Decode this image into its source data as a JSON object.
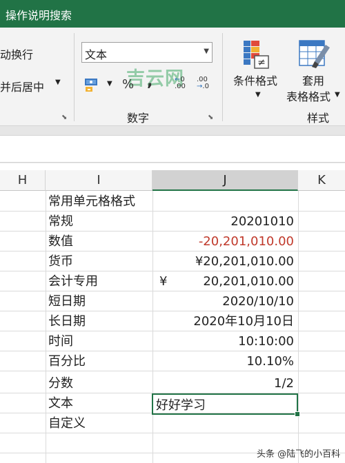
{
  "title_bar": {
    "search_label": "操作说明搜索"
  },
  "ribbon": {
    "alignment": {
      "wrap_text": "动换行",
      "merge_center": "并后居中"
    },
    "number": {
      "format_value": "文本",
      "percent_symbol": "%",
      "comma_symbol": ",",
      "increase_decimal": "←0\n.00",
      "decrease_decimal": ".00\n→.0",
      "group_label": "数字"
    },
    "styles": {
      "conditional_format": "条件格式",
      "format_as_table_line1": "套用",
      "format_as_table_line2": "表格格式",
      "group_label": "样式"
    }
  },
  "watermark": "吉云网",
  "columns": {
    "h": "H",
    "i": "I",
    "j": "J",
    "k": "K"
  },
  "rows": [
    {
      "i": "常用单元格格式",
      "j": ""
    },
    {
      "i": "常规",
      "j": "20201010"
    },
    {
      "i": "数值",
      "j": "-20,201,010.00"
    },
    {
      "i": "货币",
      "j": "¥20,201,010.00"
    },
    {
      "i": "会计专用",
      "yen": "¥",
      "j": "20,201,010.00"
    },
    {
      "i": "短日期",
      "j": "2020/10/10"
    },
    {
      "i": "长日期",
      "j": "2020年10月10日"
    },
    {
      "i": "时间",
      "j": "10:10:00"
    },
    {
      "i": "百分比",
      "j": "10.10%"
    },
    {
      "i": "分数",
      "j": "1/2"
    },
    {
      "i": "文本",
      "j": "好好学习"
    },
    {
      "i": "自定义",
      "j": ""
    }
  ],
  "colors": {
    "negative_value": "#c0392b",
    "accent": "#217346"
  },
  "credit": "头条 @陆飞的小百科"
}
